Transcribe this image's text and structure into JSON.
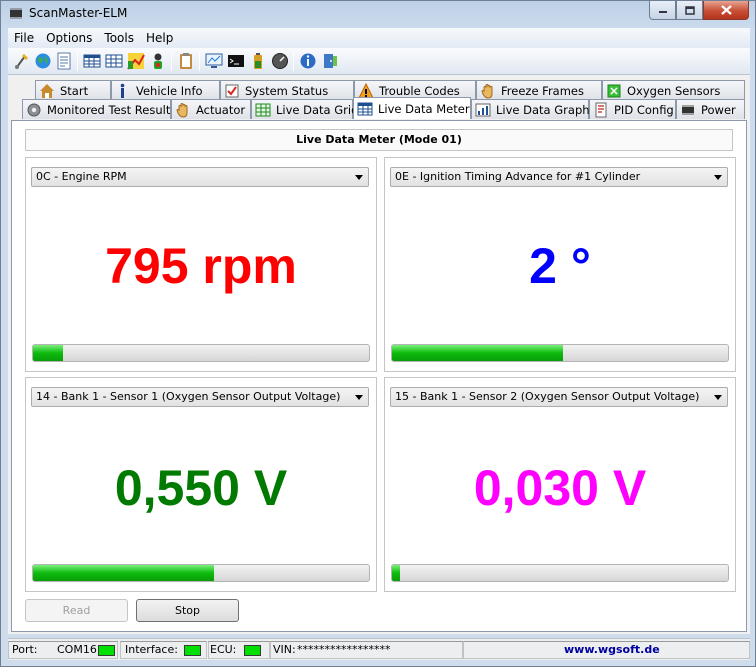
{
  "window": {
    "title": "ScanMaster-ELM",
    "controls": {
      "minimize": "minimize-icon",
      "maximize": "maximize-icon",
      "close": "close-icon"
    }
  },
  "menu": [
    "File",
    "Options",
    "Tools",
    "Help"
  ],
  "toolbar_icons": [
    "connect-icon",
    "globe-icon",
    "document-icon",
    "table-icon",
    "grid-icon",
    "chart-icon",
    "person-icon",
    "clipboard-icon",
    "monitor-icon",
    "terminal-icon",
    "battery-icon",
    "gauge-icon",
    "info-icon",
    "exit-icon"
  ],
  "tabs_back": [
    {
      "label": "Start",
      "icon": "house-icon"
    },
    {
      "label": "Vehicle Info",
      "icon": "info-icon"
    },
    {
      "label": "System Status",
      "icon": "checkbox-icon"
    },
    {
      "label": "Trouble Codes",
      "icon": "warning-icon"
    },
    {
      "label": "Freeze Frames",
      "icon": "hand-icon"
    },
    {
      "label": "Oxygen Sensors",
      "icon": "oxygen-icon"
    }
  ],
  "tabs_front": [
    {
      "label": "Monitored Test Results",
      "icon": "gear-icon"
    },
    {
      "label": "Actuator",
      "icon": "hand-icon"
    },
    {
      "label": "Live Data Grid",
      "icon": "grid-icon"
    },
    {
      "label": "Live Data Meter",
      "icon": "meter-icon",
      "active": true
    },
    {
      "label": "Live Data Graph",
      "icon": "graph-icon"
    },
    {
      "label": "PID Config",
      "icon": "config-icon"
    },
    {
      "label": "Power",
      "icon": "chip-icon"
    }
  ],
  "page": {
    "title": "Live Data Meter (Mode 01)",
    "meters": [
      {
        "pid": "0C - Engine RPM",
        "value": "795 rpm",
        "color": "#ff0000",
        "level": 0.09
      },
      {
        "pid": "0E - Ignition Timing Advance for #1 Cylinder",
        "value": "2 °",
        "color": "#0000ff",
        "level": 0.51
      },
      {
        "pid": "14 - Bank 1 - Sensor 1 (Oxygen Sensor Output Voltage)",
        "value": "0,550 V",
        "color": "#007a00",
        "level": 0.54
      },
      {
        "pid": "15 - Bank 1 - Sensor 2 (Oxygen Sensor Output Voltage)",
        "value": "0,030 V",
        "color": "#ff00ff",
        "level": 0.025
      }
    ],
    "buttons": {
      "read": "Read",
      "stop": "Stop"
    }
  },
  "statusbar": {
    "port_label": "Port:",
    "port_value": "COM16",
    "interface_label": "Interface:",
    "ecu_label": "ECU:",
    "vin_label": "VIN:",
    "vin_value": "*****************",
    "website": "www.wgsoft.de",
    "led_color": "#00e000"
  }
}
